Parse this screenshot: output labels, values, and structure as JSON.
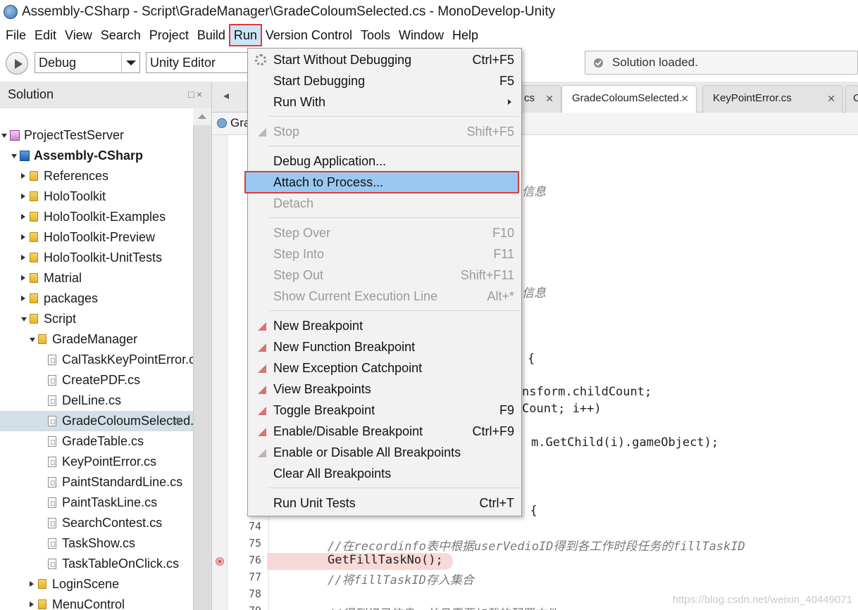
{
  "window": {
    "title": "Assembly-CSharp - Script\\GradeManager\\GradeColoumSelected.cs - MonoDevelop-Unity"
  },
  "menubar": [
    "File",
    "Edit",
    "View",
    "Search",
    "Project",
    "Build",
    "Run",
    "Version Control",
    "Tools",
    "Window",
    "Help"
  ],
  "toolbar": {
    "config": "Debug",
    "target": "Unity Editor",
    "status": "Solution loaded."
  },
  "solution": {
    "header": "Solution",
    "header_buttons": "□×",
    "items": [
      {
        "label": "ProjectTestServer"
      },
      {
        "label": "Assembly-CSharp"
      },
      {
        "label": "References"
      },
      {
        "label": "HoloToolkit"
      },
      {
        "label": "HoloToolkit-Examples"
      },
      {
        "label": "HoloToolkit-Preview"
      },
      {
        "label": "HoloToolkit-UnitTests"
      },
      {
        "label": "Matrial"
      },
      {
        "label": "packages"
      },
      {
        "label": "Script"
      },
      {
        "label": "GradeManager"
      },
      {
        "label": "CalTaskKeyPointError.cs"
      },
      {
        "label": "CreatePDF.cs"
      },
      {
        "label": "DelLine.cs"
      },
      {
        "label": "GradeColoumSelected.cs"
      },
      {
        "label": "GradeTable.cs"
      },
      {
        "label": "KeyPointError.cs"
      },
      {
        "label": "PaintStandardLine.cs"
      },
      {
        "label": "PaintTaskLine.cs"
      },
      {
        "label": "SearchContest.cs"
      },
      {
        "label": "TaskShow.cs"
      },
      {
        "label": "TaskTableOnClick.cs"
      },
      {
        "label": "LoginScene"
      },
      {
        "label": "MenuControl"
      }
    ]
  },
  "tabs": [
    {
      "label": "cs"
    },
    {
      "label": "GradeColoumSelected."
    },
    {
      "label": "KeyPointError.cs"
    },
    {
      "label": "C"
    }
  ],
  "breadcrumb": "Gra",
  "editor": {
    "fragments": [
      {
        "text": "信息"
      },
      {
        "text": "信息"
      },
      {
        "text": "{"
      },
      {
        "text": "nsform.childCount;"
      },
      {
        "text": "Count; i++)"
      },
      {
        "text": "m.GetChild(i).gameObject);"
      },
      {
        "text": ") {"
      }
    ],
    "lines": [
      {
        "no": "74",
        "text": ""
      },
      {
        "no": "75",
        "text": "//在recordinfo表中根据userVedioID得到各工作时段任务的fillTaskID"
      },
      {
        "no": "76",
        "text": "GetFillTaskNo();"
      },
      {
        "no": "77",
        "text": "//将fillTaskID存入集合"
      },
      {
        "no": "78",
        "text": ""
      },
      {
        "no": "79",
        "text": "//得到记录信息，并且需要加载的配置文件"
      }
    ]
  },
  "run_menu": {
    "items": [
      {
        "label": "Start Without Debugging",
        "shortcut": "Ctrl+F5"
      },
      {
        "label": "Start Debugging",
        "shortcut": "F5"
      },
      {
        "label": "Run With",
        "shortcut": ""
      },
      {
        "label": "Stop",
        "shortcut": "Shift+F5"
      },
      {
        "label": "Debug Application...",
        "shortcut": ""
      },
      {
        "label": "Attach to Process...",
        "shortcut": ""
      },
      {
        "label": "Detach",
        "shortcut": ""
      },
      {
        "label": "Step Over",
        "shortcut": "F10"
      },
      {
        "label": "Step Into",
        "shortcut": "F11"
      },
      {
        "label": "Step Out",
        "shortcut": "Shift+F11"
      },
      {
        "label": "Show Current Execution Line",
        "shortcut": "Alt+*"
      },
      {
        "label": "New Breakpoint",
        "shortcut": ""
      },
      {
        "label": "New Function Breakpoint",
        "shortcut": ""
      },
      {
        "label": "New Exception Catchpoint",
        "shortcut": ""
      },
      {
        "label": "View Breakpoints",
        "shortcut": ""
      },
      {
        "label": "Toggle Breakpoint",
        "shortcut": "F9"
      },
      {
        "label": "Enable/Disable Breakpoint",
        "shortcut": "Ctrl+F9"
      },
      {
        "label": "Enable or Disable All Breakpoints",
        "shortcut": ""
      },
      {
        "label": "Clear All Breakpoints",
        "shortcut": ""
      },
      {
        "label": "Run Unit Tests",
        "shortcut": "Ctrl+T"
      }
    ]
  },
  "watermark": "https://blog.csdn.net/weixin_40449071",
  "colors": {
    "highlight": "#99c9f3",
    "annotation_border": "#e03a3a",
    "breakpoint_bg": "#f8d8d8"
  }
}
